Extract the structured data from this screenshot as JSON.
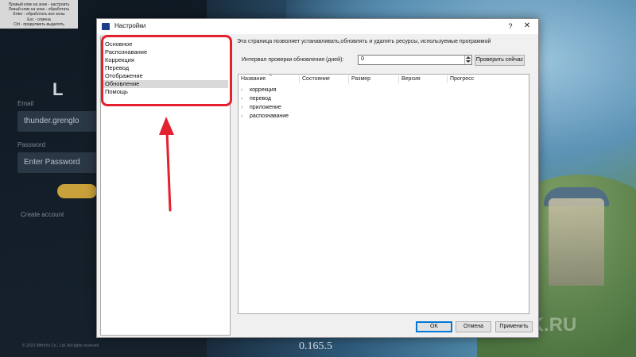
{
  "background": {
    "hint_lines": [
      "Правый клик на зоне - настроить",
      "Левый клик на зоне - обработать",
      "Enter - обработать все зоны",
      "Esc - отмена",
      "Ctrl - продолжить выделять"
    ],
    "logo": "L",
    "login_label": "Email",
    "login_value": "thunder.grenglo",
    "password_label": "Password",
    "password_value": "Enter Password",
    "create_account": "Create account",
    "copyright": "© 2023 MiHoYo Co., Ltd. All rights reserved",
    "version": "0.165.5",
    "watermark": "ACK.RU"
  },
  "dialog": {
    "title": "Настройки",
    "help_label": "?",
    "close_label": "✕",
    "nav_items": [
      {
        "label": "Основное",
        "selected": false
      },
      {
        "label": "Распознавание",
        "selected": false
      },
      {
        "label": "Коррекция",
        "selected": false
      },
      {
        "label": "Перевод",
        "selected": false
      },
      {
        "label": "Отображение",
        "selected": false
      },
      {
        "label": "Обновление",
        "selected": true
      },
      {
        "label": "Помощь",
        "selected": false
      }
    ],
    "description": "Эта страница позволяет устанавливать,обновлять и удалять ресурсы, используемые программой",
    "interval_label": "Интервал проверки обновления (дней):",
    "interval_value": "0",
    "check_now_label": "Проверить сейчас",
    "columns": [
      "Название",
      "Состояние",
      "Размер",
      "Версия",
      "Прогресс"
    ],
    "tree_items": [
      "коррекция",
      "перевод",
      "приложение",
      "распознавание"
    ],
    "ok_label": "OK",
    "cancel_label": "Отмена",
    "apply_label": "Применить"
  },
  "colors": {
    "annotation": "#e3212f",
    "selection": "#d9d9d9",
    "default_button_border": "#0078d7"
  }
}
